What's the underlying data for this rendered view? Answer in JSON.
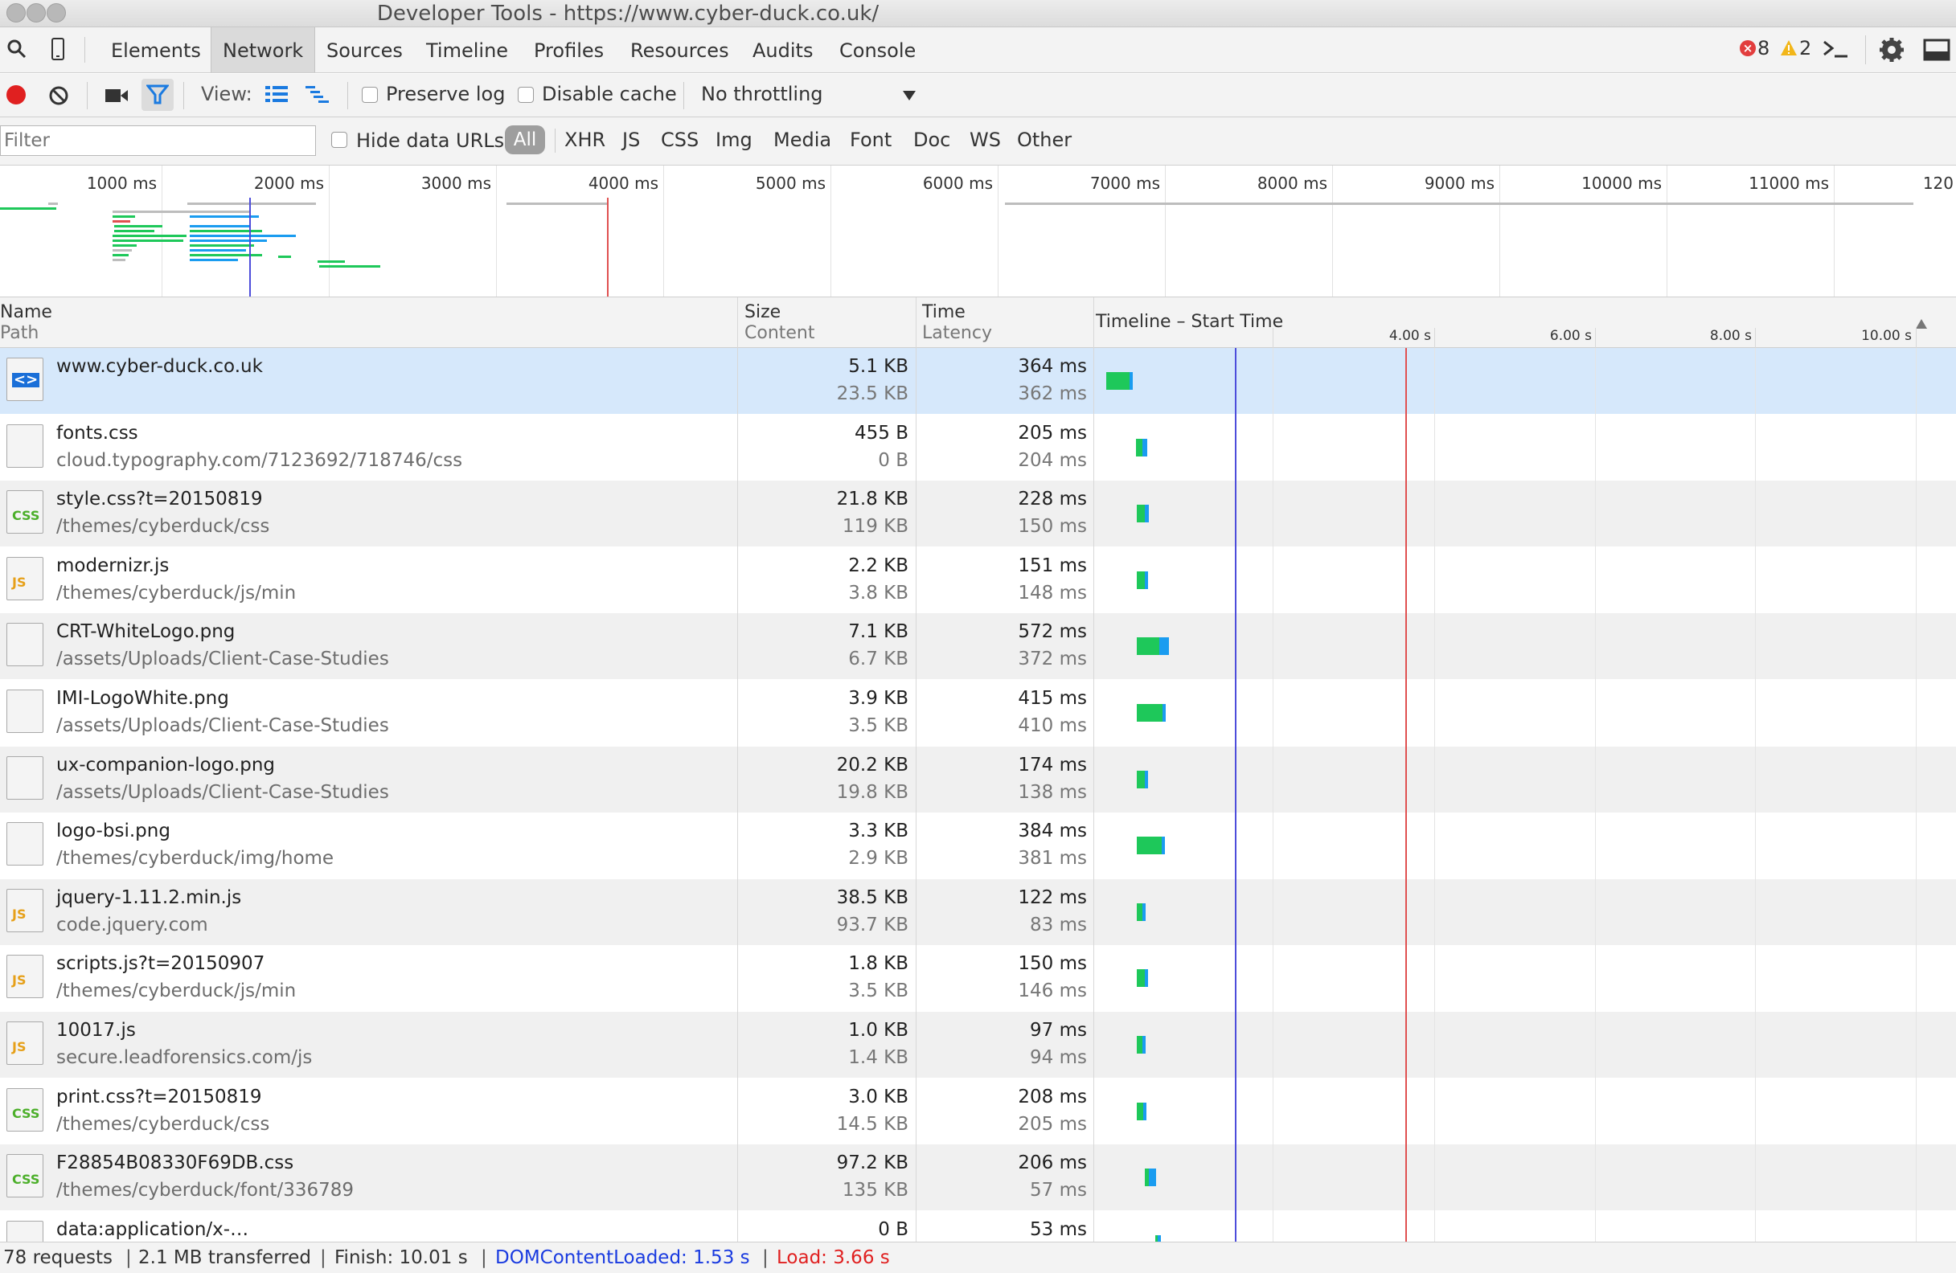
{
  "window": {
    "title": "Developer Tools - https://www.cyber-duck.co.uk/"
  },
  "tabs": [
    "Elements",
    "Network",
    "Sources",
    "Timeline",
    "Profiles",
    "Resources",
    "Audits",
    "Console"
  ],
  "active_tab": "Network",
  "status_counts": {
    "errors": "8",
    "warnings": "2"
  },
  "network_toolbar": {
    "view_label": "View:",
    "preserve_log_label": "Preserve log",
    "disable_cache_label": "Disable cache",
    "throttling_value": "No throttling"
  },
  "filter_bar": {
    "filter_placeholder": "Filter",
    "hide_data_urls_label": "Hide data URLs",
    "types": [
      "All",
      "XHR",
      "JS",
      "CSS",
      "Img",
      "Media",
      "Font",
      "Doc",
      "WS",
      "Other"
    ],
    "active_type": "All"
  },
  "overview": {
    "labels": [
      "1000 ms",
      "2000 ms",
      "3000 ms",
      "4000 ms",
      "5000 ms",
      "6000 ms",
      "7000 ms",
      "8000 ms",
      "9000 ms",
      "10000 ms",
      "11000 ms",
      "120"
    ]
  },
  "table_header": {
    "name": "Name",
    "path": "Path",
    "size": "Size",
    "content": "Content",
    "time": "Time",
    "latency": "Latency",
    "timeline": "Timeline – Start Time",
    "ticks": [
      "4.00 s",
      "6.00 s",
      "8.00 s",
      "10.00 s"
    ]
  },
  "requests": [
    {
      "name": "www.cyber-duck.co.uk",
      "path": "",
      "size": "5.1 KB",
      "content": "23.5 KB",
      "time": "364 ms",
      "latency": "362 ms",
      "icon": "html-doc-icon",
      "tag": "<>",
      "tag_color": "#1a6fd8",
      "start_s": 0.25,
      "wait_s": 0.36,
      "recv_s": 0.05
    },
    {
      "name": "fonts.css",
      "path": "cloud.typography.com/7123692/718746/css",
      "size": "455 B",
      "content": "0 B",
      "time": "205 ms",
      "latency": "204 ms",
      "icon": "blank-file-icon",
      "tag": "",
      "tag_color": "",
      "start_s": 0.95,
      "wait_s": 0.1,
      "recv_s": 0.1
    },
    {
      "name": "style.css?t=20150819",
      "path": "/themes/cyberduck/css",
      "size": "21.8 KB",
      "content": "119 KB",
      "time": "228 ms",
      "latency": "150 ms",
      "icon": "css-file-icon",
      "tag": "CSS",
      "tag_color": "#4caf2a",
      "start_s": 0.97,
      "wait_s": 0.12,
      "recv_s": 0.08
    },
    {
      "name": "modernizr.js",
      "path": "/themes/cyberduck/js/min",
      "size": "2.2 KB",
      "content": "3.8 KB",
      "time": "151 ms",
      "latency": "148 ms",
      "icon": "js-file-icon",
      "tag": "JS",
      "tag_color": "#e6a019",
      "start_s": 0.97,
      "wait_s": 0.12,
      "recv_s": 0.02
    },
    {
      "name": "CRT-WhiteLogo.png",
      "path": "/assets/Uploads/Client-Case-Studies",
      "size": "7.1 KB",
      "content": "6.7 KB",
      "time": "572 ms",
      "latency": "372 ms",
      "icon": "image-file-icon",
      "tag": "",
      "tag_color": "",
      "start_s": 0.97,
      "wait_s": 0.35,
      "recv_s": 0.2
    },
    {
      "name": "IMI-LogoWhite.png",
      "path": "/assets/Uploads/Client-Case-Studies",
      "size": "3.9 KB",
      "content": "3.5 KB",
      "time": "415 ms",
      "latency": "410 ms",
      "icon": "image-file-icon",
      "tag": "",
      "tag_color": "",
      "start_s": 0.97,
      "wait_s": 0.4,
      "recv_s": 0.02
    },
    {
      "name": "ux-companion-logo.png",
      "path": "/assets/Uploads/Client-Case-Studies",
      "size": "20.2 KB",
      "content": "19.8 KB",
      "time": "174 ms",
      "latency": "138 ms",
      "icon": "image-file-icon",
      "tag": "",
      "tag_color": "",
      "start_s": 0.97,
      "wait_s": 0.12,
      "recv_s": 0.04
    },
    {
      "name": "logo-bsi.png",
      "path": "/themes/cyberduck/img/home",
      "size": "3.3 KB",
      "content": "2.9 KB",
      "time": "384 ms",
      "latency": "381 ms",
      "icon": "image-file-icon",
      "tag": "",
      "tag_color": "",
      "start_s": 0.97,
      "wait_s": 0.38,
      "recv_s": 0.02
    },
    {
      "name": "jquery-1.11.2.min.js",
      "path": "code.jquery.com",
      "size": "38.5 KB",
      "content": "93.7 KB",
      "time": "122 ms",
      "latency": "83 ms",
      "icon": "js-file-icon",
      "tag": "JS",
      "tag_color": "#e6a019",
      "start_s": 0.97,
      "wait_s": 0.08,
      "recv_s": 0.04
    },
    {
      "name": "scripts.js?t=20150907",
      "path": "/themes/cyberduck/js/min",
      "size": "1.8 KB",
      "content": "3.5 KB",
      "time": "150 ms",
      "latency": "146 ms",
      "icon": "js-file-icon",
      "tag": "JS",
      "tag_color": "#e6a019",
      "start_s": 0.97,
      "wait_s": 0.12,
      "recv_s": 0.02
    },
    {
      "name": "10017.js",
      "path": "secure.leadforensics.com/js",
      "size": "1.0 KB",
      "content": "1.4 KB",
      "time": "97 ms",
      "latency": "94 ms",
      "icon": "js-file-icon",
      "tag": "JS",
      "tag_color": "#e6a019",
      "start_s": 0.97,
      "wait_s": 0.08,
      "recv_s": 0.02
    },
    {
      "name": "print.css?t=20150819",
      "path": "/themes/cyberduck/css",
      "size": "3.0 KB",
      "content": "14.5 KB",
      "time": "208 ms",
      "latency": "205 ms",
      "icon": "css-file-icon",
      "tag": "CSS",
      "tag_color": "#4caf2a",
      "start_s": 0.97,
      "wait_s": 0.1,
      "recv_s": 0.06
    },
    {
      "name": "F28854B08330F69DB.css",
      "path": "/themes/cyberduck/font/336789",
      "size": "97.2 KB",
      "content": "135 KB",
      "time": "206 ms",
      "latency": "57 ms",
      "icon": "css-file-icon",
      "tag": "CSS",
      "tag_color": "#4caf2a",
      "start_s": 1.15,
      "wait_s": 0.06,
      "recv_s": 0.15
    },
    {
      "name": "data:application/x-…",
      "path": "",
      "size": "0 B",
      "content": "",
      "time": "53 ms",
      "latency": "",
      "icon": "blank-file-icon",
      "tag": "",
      "tag_color": "",
      "start_s": 1.4,
      "wait_s": 0.02,
      "recv_s": 0.04
    }
  ],
  "status_bar": {
    "requests": "78 requests",
    "transferred": "2.1 MB transferred",
    "finish": "Finish: 10.01 s",
    "dom_content_loaded": "DOMContentLoaded: 1.53 s",
    "load": "Load: 3.66 s"
  },
  "colors": {
    "waiting": "#1ec85a",
    "receiving": "#1a9cf0",
    "dom_line": "#4d4ddb",
    "load_line": "#e05050",
    "selected_row": "#d6e8fb"
  }
}
